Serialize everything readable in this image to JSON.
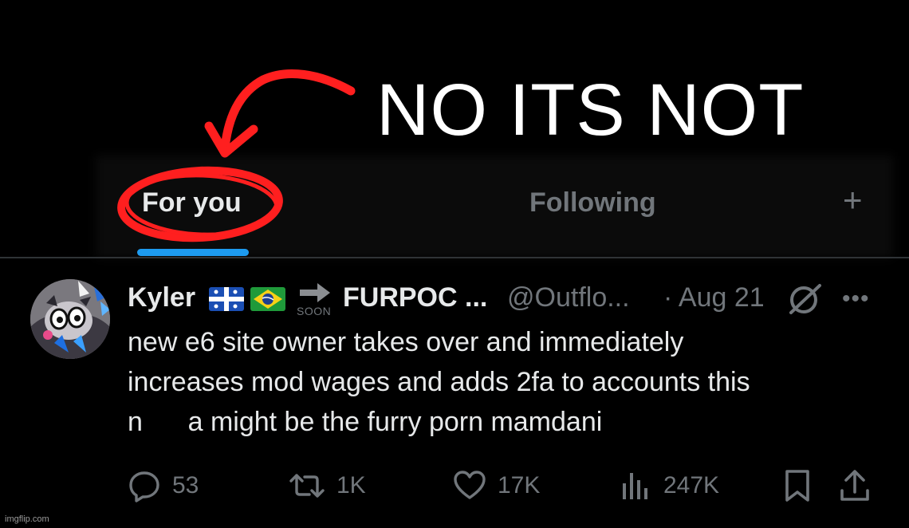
{
  "caption": {
    "text": "NO ITS NOT"
  },
  "tabs": {
    "for_you": "For you",
    "following": "Following",
    "add": "+"
  },
  "post": {
    "display_name": "Kyler",
    "soon_label": "SOON",
    "display_name_2": "FURPOC ...",
    "handle": "@Outflo...",
    "date": "· Aug 21",
    "more": "•••",
    "body_lines": [
      "new e6 site owner takes over and immediately",
      "increases mod wages and adds 2fa to accounts this",
      "n      a might be the furry porn mamdani"
    ]
  },
  "actions": {
    "replies": "53",
    "reposts": "1K",
    "likes": "17K",
    "views": "247K"
  },
  "watermark": "imgflip.com",
  "colors": {
    "background": "#000000",
    "text_primary": "#e7e9ea",
    "text_secondary": "#71767b",
    "accent": "#1d9bf0",
    "annotation": "#ff1f1f",
    "divider": "#2f3336"
  }
}
